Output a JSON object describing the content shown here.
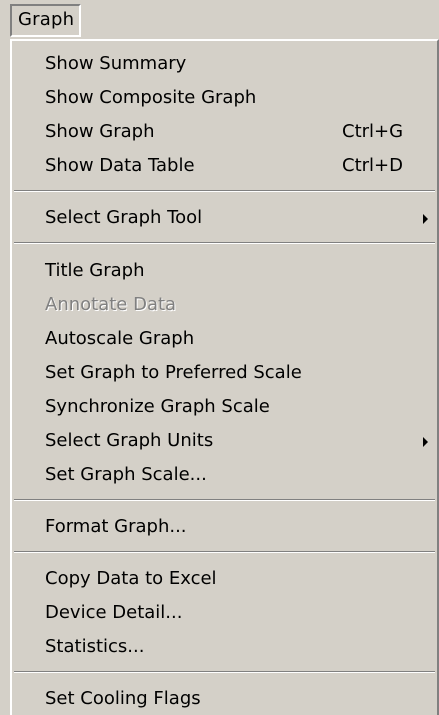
{
  "menubar": {
    "graph_label": "Graph"
  },
  "menu": {
    "items": [
      {
        "label": "Show Summary"
      },
      {
        "label": "Show Composite Graph"
      },
      {
        "label": "Show Graph",
        "shortcut": "Ctrl+G"
      },
      {
        "label": "Show Data Table",
        "shortcut": "Ctrl+D"
      },
      {
        "label": "Select Graph Tool",
        "submenu": true
      },
      {
        "label": "Title Graph"
      },
      {
        "label": "Annotate Data",
        "disabled": true
      },
      {
        "label": "Autoscale Graph"
      },
      {
        "label": "Set Graph to Preferred Scale"
      },
      {
        "label": "Synchronize Graph Scale"
      },
      {
        "label": "Select Graph Units",
        "submenu": true
      },
      {
        "label": "Set Graph Scale..."
      },
      {
        "label": "Format Graph..."
      },
      {
        "label": "Copy Data to Excel"
      },
      {
        "label": "Device Detail..."
      },
      {
        "label": "Statistics..."
      },
      {
        "label": "Set Cooling Flags"
      }
    ]
  },
  "colors": {
    "menu_face": "#d4d0c8",
    "disabled_text": "#808080",
    "highlight": "#ffffff",
    "shadow": "#808080"
  }
}
